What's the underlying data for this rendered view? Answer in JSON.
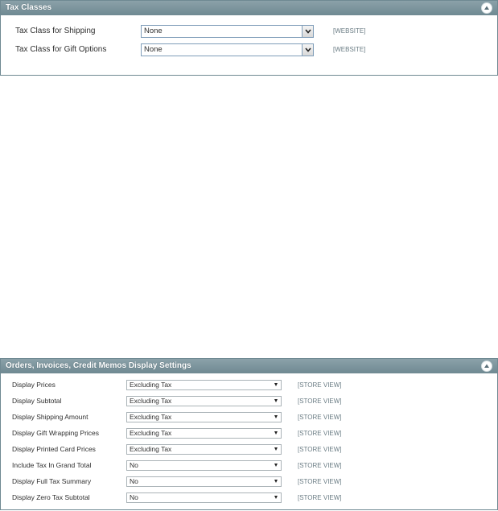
{
  "tax_classes": {
    "title": "Tax Classes",
    "collapse_icon": "collapse-up-icon",
    "rows": [
      {
        "label": "Tax Class for Shipping",
        "value": "None",
        "scope": "[WEBSITE]"
      },
      {
        "label": "Tax Class for Gift Options",
        "value": "None",
        "scope": "[WEBSITE]"
      }
    ]
  },
  "orders_display": {
    "title": "Orders, Invoices, Credit Memos Display Settings",
    "collapse_icon": "collapse-up-icon",
    "rows": [
      {
        "label": "Display Prices",
        "value": "Excluding Tax",
        "scope": "[STORE VIEW]"
      },
      {
        "label": "Display Subtotal",
        "value": "Excluding Tax",
        "scope": "[STORE VIEW]"
      },
      {
        "label": "Display Shipping Amount",
        "value": "Excluding Tax",
        "scope": "[STORE VIEW]"
      },
      {
        "label": "Display Gift Wrapping Prices",
        "value": "Excluding Tax",
        "scope": "[STORE VIEW]"
      },
      {
        "label": "Display Printed Card Prices",
        "value": "Excluding Tax",
        "scope": "[STORE VIEW]"
      },
      {
        "label": "Include Tax In Grand Total",
        "value": "No",
        "scope": "[STORE VIEW]"
      },
      {
        "label": "Display Full Tax Summary",
        "value": "No",
        "scope": "[STORE VIEW]"
      },
      {
        "label": "Display Zero Tax Subtotal",
        "value": "No",
        "scope": "[STORE VIEW]"
      }
    ]
  },
  "colors": {
    "header_bg": "#6f8992",
    "scope_text": "#6a7c84"
  }
}
